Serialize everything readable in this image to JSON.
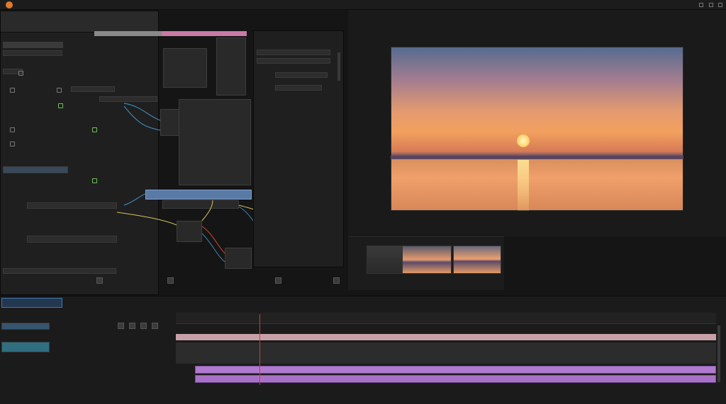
{
  "colors": {
    "accent_blue": "#3f78b2",
    "clip_purple": "#b07ad0",
    "playhead": "#d13a3a",
    "green": "#6fbf5a",
    "pink": "#c97aa6"
  },
  "menu": {
    "items": [
      "",
      "",
      "",
      "",
      "",
      "",
      "",
      "",
      ""
    ],
    "right_text": ""
  },
  "icons": [
    "app-logo-icon",
    "eye-icon",
    "lock-icon",
    "gear-icon",
    "play-icon",
    "search-icon"
  ],
  "timeline": {
    "tab_label": ""
  }
}
